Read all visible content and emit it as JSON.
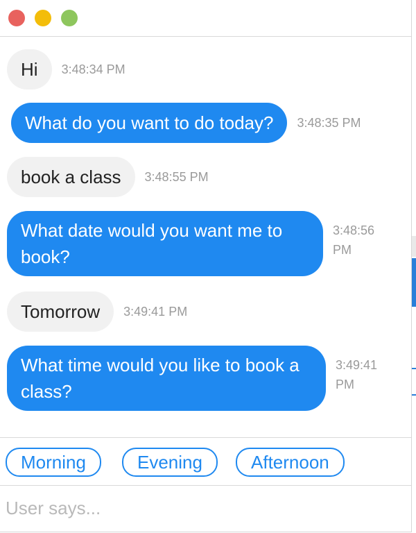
{
  "window": {
    "controls": [
      "close",
      "minimize",
      "zoom"
    ]
  },
  "messages": [
    {
      "sender": "user",
      "text": "Hi",
      "time": "3:48:34 PM"
    },
    {
      "sender": "bot",
      "text": "What do you want to do today?",
      "time": "3:48:35 PM"
    },
    {
      "sender": "user",
      "text": "book a class",
      "time": "3:48:55 PM"
    },
    {
      "sender": "bot",
      "text": "What date would you want me to book?",
      "time": "3:48:56 PM"
    },
    {
      "sender": "user",
      "text": "Tomorrow",
      "time": "3:49:41 PM"
    },
    {
      "sender": "bot",
      "text": "What time would you like to book a class?",
      "time": "3:49:41 PM"
    }
  ],
  "quick_replies": [
    "Morning",
    "Evening",
    "Afternoon"
  ],
  "input": {
    "placeholder": "User says...",
    "value": ""
  },
  "colors": {
    "bot_bubble": "#1f89f0",
    "user_bubble": "#f1f1f1",
    "accent": "#1f89f0",
    "close": "#e8625e",
    "minimize": "#f3bd0a",
    "zoom": "#8ec65d"
  }
}
